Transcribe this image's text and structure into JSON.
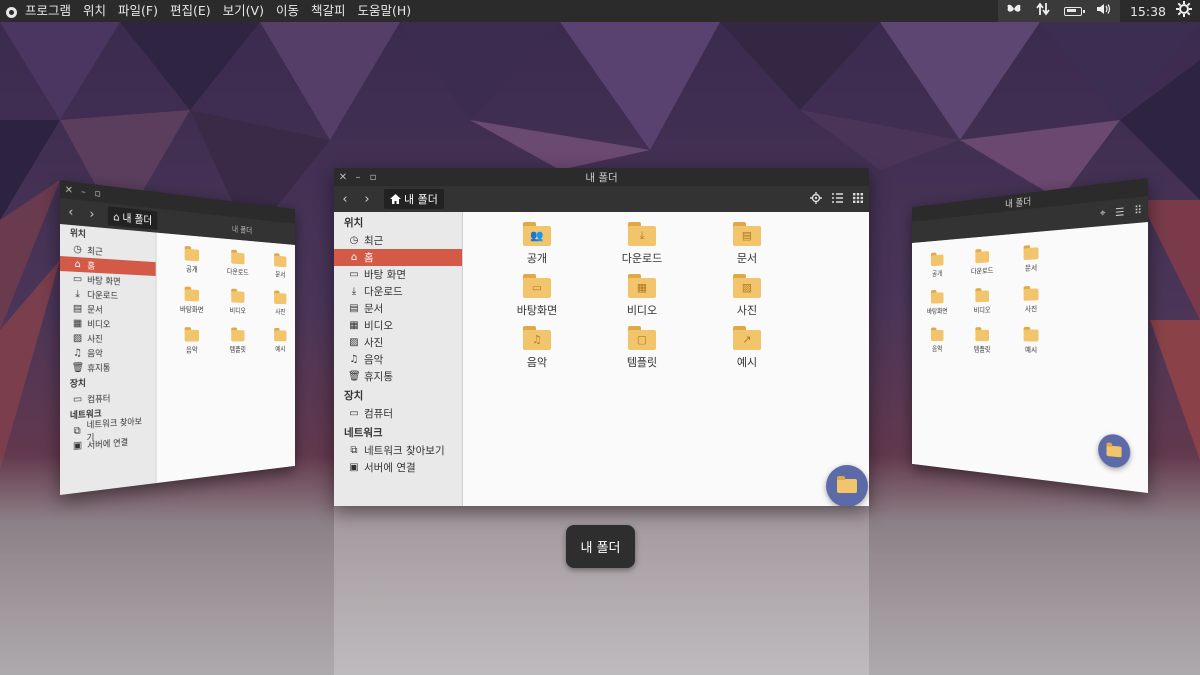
{
  "top_panel": {
    "menu": [
      "프로그램",
      "위치",
      "파일(F)",
      "편집(E)",
      "보기(V)",
      "이동",
      "책갈피",
      "도움말(H)"
    ],
    "clock": "15:38",
    "tray_icons": [
      "butterfly-icon",
      "network-arrows-icon",
      "battery-icon",
      "volume-icon",
      "power-gear-icon"
    ]
  },
  "main_window": {
    "title": "내 폴더",
    "breadcrumb": "내 폴더",
    "nav": {
      "back": "‹",
      "forward": "›"
    },
    "sidebar": {
      "sections": [
        {
          "heading": "위치",
          "items": [
            {
              "label": "최근",
              "icon": "clock-icon"
            },
            {
              "label": "홈",
              "icon": "home-icon",
              "active": true
            },
            {
              "label": "바탕 화면",
              "icon": "desktop-icon"
            },
            {
              "label": "다운로드",
              "icon": "download-icon"
            },
            {
              "label": "문서",
              "icon": "document-icon"
            },
            {
              "label": "비디오",
              "icon": "video-icon"
            },
            {
              "label": "사진",
              "icon": "image-icon"
            },
            {
              "label": "음악",
              "icon": "music-icon"
            },
            {
              "label": "휴지통",
              "icon": "trash-icon"
            }
          ]
        },
        {
          "heading": "장치",
          "items": [
            {
              "label": "컴퓨터",
              "icon": "computer-icon"
            }
          ]
        },
        {
          "heading": "네트워크",
          "items": [
            {
              "label": "네트워크 찾아보기",
              "icon": "network-icon"
            },
            {
              "label": "서버에 연결",
              "icon": "server-icon"
            }
          ]
        }
      ]
    },
    "folders": [
      {
        "label": "공개",
        "glyph": "👥"
      },
      {
        "label": "다운로드",
        "glyph": "⤓"
      },
      {
        "label": "문서",
        "glyph": "▤"
      },
      {
        "label": "바탕화면",
        "glyph": "▭"
      },
      {
        "label": "비디오",
        "glyph": "▦"
      },
      {
        "label": "사진",
        "glyph": "▨"
      },
      {
        "label": "음악",
        "glyph": "♫"
      },
      {
        "label": "템플릿",
        "glyph": "▢"
      },
      {
        "label": "예시",
        "glyph": "↗"
      }
    ]
  },
  "left_window": {
    "sidebar": {
      "sections": [
        {
          "heading": "위치",
          "items": [
            {
              "label": "최근",
              "icon": "clock-icon"
            },
            {
              "label": "홈",
              "icon": "home-icon",
              "active": true
            },
            {
              "label": "바탕 화면",
              "icon": "desktop-icon"
            },
            {
              "label": "다운로드",
              "icon": "download-icon"
            },
            {
              "label": "문서",
              "icon": "document-icon"
            },
            {
              "label": "비디오",
              "icon": "video-icon"
            },
            {
              "label": "사진",
              "icon": "image-icon"
            },
            {
              "label": "음악",
              "icon": "music-icon"
            },
            {
              "label": "휴지통",
              "icon": "trash-icon"
            }
          ]
        },
        {
          "heading": "장치",
          "items": [
            {
              "label": "컴퓨터",
              "icon": "computer-icon"
            }
          ]
        },
        {
          "heading": "네트워크",
          "items": [
            {
              "label": "네트워크 찾아보기",
              "icon": "network-icon"
            },
            {
              "label": "서버에 연결",
              "icon": "server-icon"
            }
          ]
        }
      ]
    },
    "folders": [
      {
        "label": "공개"
      },
      {
        "label": "다운로드"
      },
      {
        "label": "문서"
      },
      {
        "label": "바탕화면"
      },
      {
        "label": "비디오"
      },
      {
        "label": "사진"
      },
      {
        "label": "음악"
      },
      {
        "label": "템플릿"
      },
      {
        "label": "예시"
      }
    ],
    "breadcrumb": "내 폴더",
    "title": "내 폴더"
  },
  "right_window": {
    "title": "내 폴더",
    "folders": [
      {
        "label": "공개"
      },
      {
        "label": "다운로드"
      },
      {
        "label": "문서"
      },
      {
        "label": "바탕화면"
      },
      {
        "label": "비디오"
      },
      {
        "label": "사진"
      },
      {
        "label": "음악"
      },
      {
        "label": "템플릿"
      },
      {
        "label": "예시"
      }
    ]
  },
  "tooltip": {
    "text": "내 폴더"
  },
  "colors": {
    "panel": "#2b2b2b",
    "active_item": "#d35a47",
    "folder": "#f2c46b",
    "folder_tab": "#e0a846",
    "fab": "#5d6aa8",
    "sidebar_bg": "#e9e9e9"
  }
}
